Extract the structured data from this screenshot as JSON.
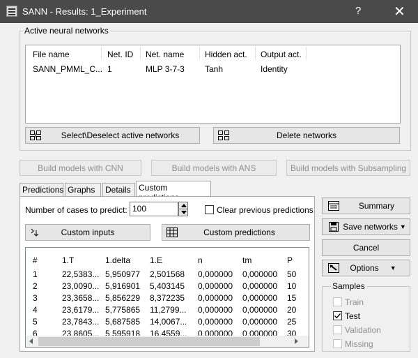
{
  "window": {
    "title": "SANN - Results: 1_Experiment",
    "help": "?",
    "close": "✕"
  },
  "active_networks": {
    "legend": "Active neural networks",
    "columns": [
      "File name",
      "Net. ID",
      "Net. name",
      "Hidden act.",
      "Output act."
    ],
    "rows": [
      [
        "SANN_PMML_C...",
        "1",
        "MLP 3-7-3",
        "Tanh",
        "Identity"
      ]
    ],
    "select_btn": "Select\\Deselect active networks",
    "delete_btn": "Delete networks"
  },
  "build": {
    "cnn": "Build models with CNN",
    "ans": "Build  models with ANS",
    "subsampling": "Build models with Subsampling"
  },
  "tabs": [
    "Predictions",
    "Graphs",
    "Details",
    "Custom predictions"
  ],
  "custom": {
    "cases_label": "Number of cases to predict:",
    "cases_value": "100",
    "clear_label": "Clear previous predictions",
    "inputs_btn": "Custom inputs",
    "predictions_btn": "Custom predictions",
    "columns": [
      "#",
      "1.T",
      "1.delta",
      "1.E",
      "n",
      "tm",
      "P"
    ],
    "rows": [
      [
        "1",
        "22,5383...",
        "5,950977",
        "2,501568",
        "0,000000",
        "0,000000",
        "50"
      ],
      [
        "2",
        "23,0090...",
        "5,916901",
        "5,403145",
        "0,000000",
        "0,000000",
        "10"
      ],
      [
        "3",
        "23,3658...",
        "5,856229",
        "8,372235",
        "0,000000",
        "0,000000",
        "15"
      ],
      [
        "4",
        "23,6179...",
        "5,775865",
        "11,2799...",
        "0,000000",
        "0,000000",
        "20"
      ],
      [
        "5",
        "23,7843...",
        "5,687585",
        "14,0067...",
        "0,000000",
        "0,000000",
        "25"
      ],
      [
        "6",
        "23,8605...",
        "5,595918",
        "16,4559...",
        "0,000000",
        "0,000000",
        "30"
      ]
    ]
  },
  "side": {
    "summary": "Summary",
    "save": "Save networks",
    "cancel": "Cancel",
    "options": "Options",
    "samples_legend": "Samples",
    "samples": [
      {
        "label": "Train",
        "checked": false,
        "enabled": false
      },
      {
        "label": "Test",
        "checked": true,
        "enabled": true
      },
      {
        "label": "Validation",
        "checked": false,
        "enabled": false
      },
      {
        "label": "Missing",
        "checked": false,
        "enabled": false
      }
    ]
  }
}
